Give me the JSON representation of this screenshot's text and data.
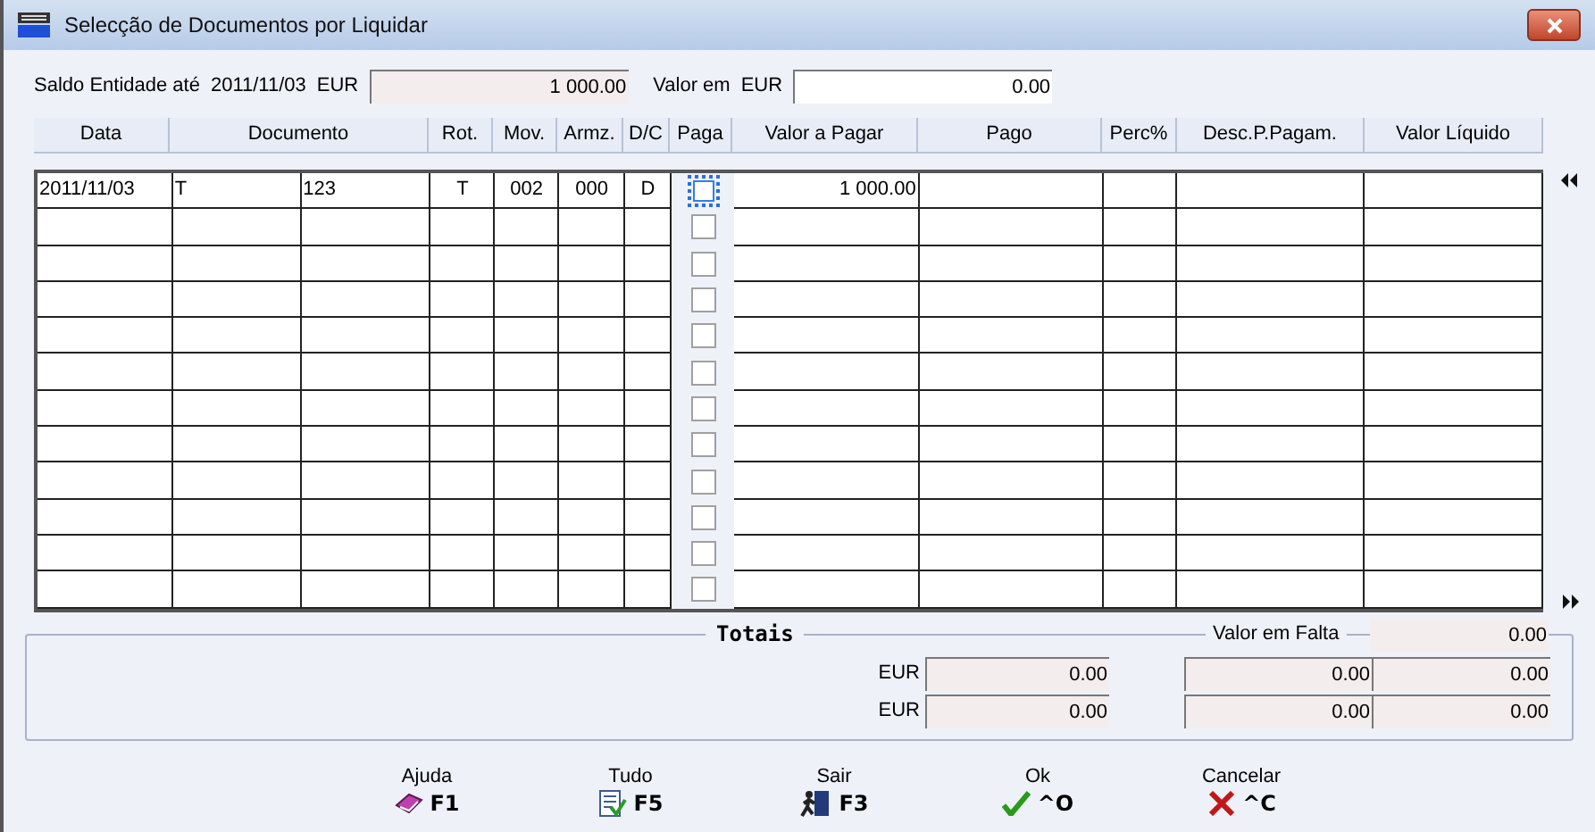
{
  "window": {
    "title": "Selecção de Documentos por Liquidar"
  },
  "header": {
    "saldo_label": "Saldo Entidade até",
    "date": "2011/11/03",
    "currency": "EUR",
    "saldo_value": "1 000.00",
    "valor_label": "Valor em",
    "valor_currency": "EUR",
    "valor_value": "0.00"
  },
  "table": {
    "columns": [
      "Data",
      "Documento",
      "Rot.",
      "Mov.",
      "Armz.",
      "D/C",
      "Paga",
      "Valor a Pagar",
      "Pago",
      "Perc%",
      "Desc.P.Pagam.",
      "Valor Líquido"
    ],
    "rows": [
      {
        "cells": [
          "2011/11/03",
          "T",
          "123",
          "T",
          "002",
          "000",
          "D",
          "1 000.00"
        ],
        "checked": false,
        "focused": true
      },
      {
        "checked": false,
        "focused": false
      },
      {
        "checked": false,
        "focused": false
      },
      {
        "checked": false,
        "focused": false
      },
      {
        "checked": false,
        "focused": false
      },
      {
        "checked": false,
        "focused": false
      },
      {
        "checked": false,
        "focused": false
      },
      {
        "checked": false,
        "focused": false
      },
      {
        "checked": false,
        "focused": false
      },
      {
        "checked": false,
        "focused": false
      },
      {
        "checked": false,
        "focused": false
      },
      {
        "checked": false,
        "focused": false
      }
    ]
  },
  "totals": {
    "title": "Totais",
    "missing_label": "Valor em Falta",
    "missing_value": "0.00",
    "rows": [
      {
        "currency": "EUR",
        "values": [
          "0.00",
          "0.00",
          "0.00"
        ]
      },
      {
        "currency": "EUR",
        "values": [
          "0.00",
          "0.00",
          "0.00"
        ]
      }
    ]
  },
  "buttons": [
    {
      "kind": "help",
      "label": "Ajuda",
      "key": "F1"
    },
    {
      "kind": "all",
      "label": "Tudo",
      "key": "F5"
    },
    {
      "kind": "exit",
      "label": "Sair",
      "key": "F3"
    },
    {
      "kind": "ok",
      "label": "Ok",
      "key": "^O"
    },
    {
      "kind": "cancel",
      "label": "Cancelar",
      "key": "^C"
    }
  ]
}
